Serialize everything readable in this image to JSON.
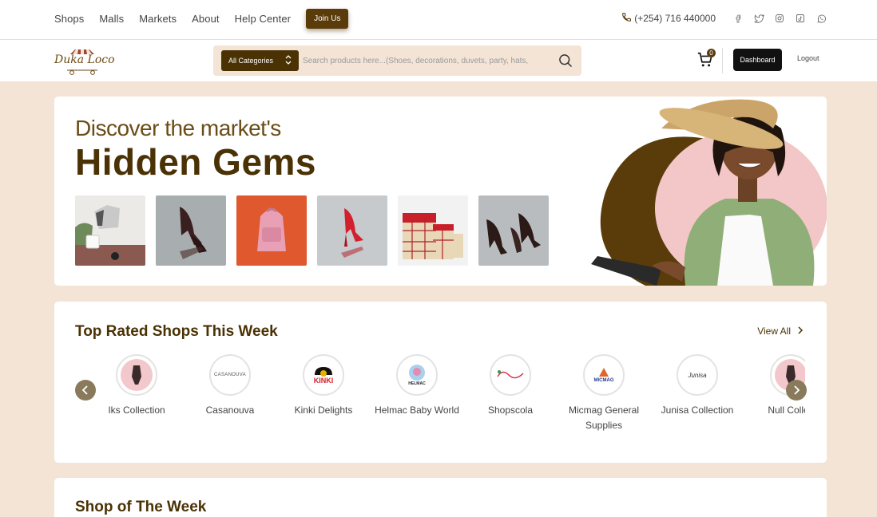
{
  "topnav": {
    "links": [
      "Shops",
      "Malls",
      "Markets",
      "About",
      "Help Center"
    ],
    "join_label": "Join Us",
    "phone": "(+254) 716 440000",
    "social_icons": [
      "facebook-icon",
      "twitter-icon",
      "instagram-icon",
      "tiktok-icon",
      "whatsapp-icon"
    ]
  },
  "header": {
    "logo_text": "Duka Loco",
    "category_label": "All Categories",
    "search_placeholder": "Search products here...(Shoes, decorations, duvets, party, hats,",
    "cart_count": "0",
    "dashboard_label": "Dashboard",
    "logout_label": "Logout"
  },
  "hero": {
    "subtitle": "Discover the market's",
    "title": "Hidden Gems",
    "thumbnails": [
      "kettle",
      "brown-heels",
      "pink-backpack",
      "red-heels",
      "plaid-bags",
      "brown-platform-heels"
    ]
  },
  "top_shops": {
    "title": "Top Rated Shops This Week",
    "view_all": "View All",
    "shops": [
      {
        "name": "Iks Collection"
      },
      {
        "name": "Casanouva"
      },
      {
        "name": "Kinki Delights"
      },
      {
        "name": "Helmac Baby World"
      },
      {
        "name": "Shopscola"
      },
      {
        "name": "Micmag General Supplies"
      },
      {
        "name": "Junisa Collection"
      },
      {
        "name": "Null Collec"
      }
    ],
    "logo_texts": {
      "casanouva": "CASANOUVA",
      "kinki": "KINKI",
      "helmac": "HELMAC",
      "micmag": "MICMAG",
      "junisa": "Junisa"
    }
  },
  "week": {
    "title": "Shop of The Week"
  },
  "colors": {
    "brand_brown": "#4a3205",
    "page_bg": "#f3e4d6"
  }
}
